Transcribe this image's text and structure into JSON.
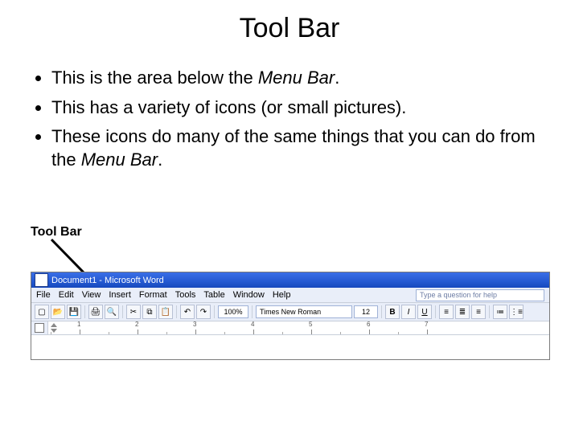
{
  "title": "Tool Bar",
  "bullets": [
    {
      "pre": "This is the area below the ",
      "em": "Menu Bar",
      "post": "."
    },
    {
      "pre": "This has a variety of icons (or small pictures).",
      "em": "",
      "post": ""
    },
    {
      "pre": "These icons do many of the same things that you can do from the ",
      "em": "Menu Bar",
      "post": "."
    }
  ],
  "callout_label": "Tool Bar",
  "word": {
    "titlebar": "Document1 - Microsoft Word",
    "menus": [
      "File",
      "Edit",
      "View",
      "Insert",
      "Format",
      "Tools",
      "Table",
      "Window",
      "Help"
    ],
    "help_placeholder": "Type a question for help",
    "zoom": "100%",
    "font": "Times New Roman",
    "size": "12",
    "bold": "B",
    "italic": "I",
    "underline": "U",
    "ruler_numbers": [
      "1",
      "2",
      "3",
      "4",
      "5",
      "6",
      "7"
    ]
  }
}
